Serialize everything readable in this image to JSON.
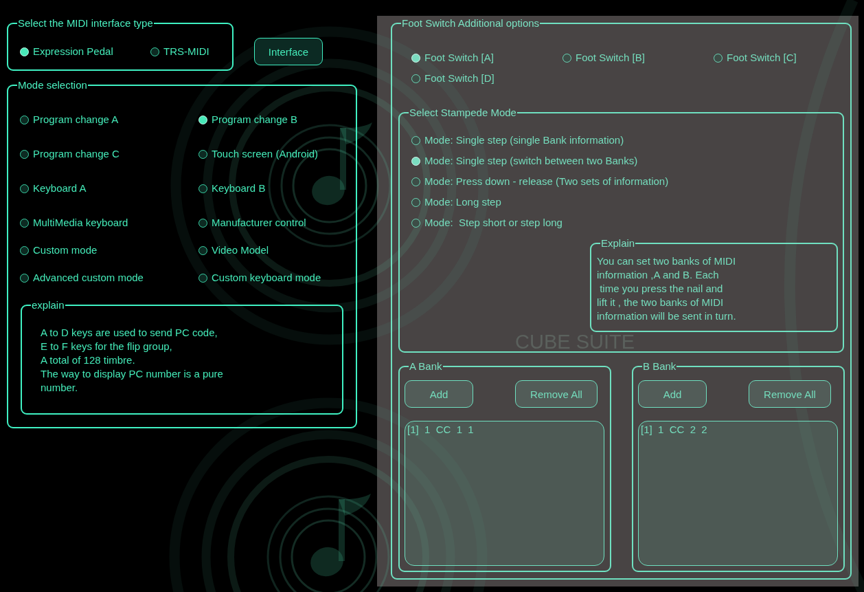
{
  "interface_type": {
    "title": "Select the MIDI interface type",
    "options": [
      {
        "label": "Expression Pedal",
        "selected": true
      },
      {
        "label": "TRS-MIDI",
        "selected": false
      }
    ]
  },
  "interface_button": {
    "label": "Interface"
  },
  "mode_selection": {
    "title": "Mode selection",
    "options": [
      {
        "label": "Program change A",
        "selected": false
      },
      {
        "label": "Program change B",
        "selected": true
      },
      {
        "label": "Program change C",
        "selected": false
      },
      {
        "label": "Touch screen (Android)",
        "selected": false
      },
      {
        "label": "Keyboard A",
        "selected": false
      },
      {
        "label": "Keyboard B",
        "selected": false
      },
      {
        "label": "MultiMedia keyboard",
        "selected": false
      },
      {
        "label": "Manufacturer control",
        "selected": false
      },
      {
        "label": "Custom mode",
        "selected": false
      },
      {
        "label": "Video Model",
        "selected": false
      },
      {
        "label": "Advanced custom mode",
        "selected": false
      },
      {
        "label": "Custom keyboard mode",
        "selected": false
      }
    ],
    "explain": {
      "title": "explain",
      "lines": [
        "A to D keys are used to send PC code,",
        "E to F keys for the flip group,",
        "A total of 128 timbre.",
        "The way to display PC number is a pure",
        "number."
      ]
    }
  },
  "foot_switch_options": {
    "title": "Foot Switch Additional options",
    "switches": [
      {
        "label": "Foot Switch [A]",
        "selected": true
      },
      {
        "label": "Foot Switch [B]",
        "selected": false
      },
      {
        "label": "Foot Switch [C]",
        "selected": false
      },
      {
        "label": "Foot Switch [D]",
        "selected": false
      }
    ],
    "stampede_mode": {
      "title": "Select Stampede Mode",
      "options": [
        {
          "label": "Mode: Single step (single Bank information)",
          "selected": false
        },
        {
          "label": "Mode: Single step (switch between two Banks)",
          "selected": true
        },
        {
          "label": "Mode: Press down - release (Two sets of information)",
          "selected": false
        },
        {
          "label": "Mode: Long step",
          "selected": false
        },
        {
          "label": "Mode:  Step short or step long",
          "selected": false
        }
      ],
      "explain": {
        "title": "Explain",
        "lines": [
          "You can set two banks of MIDI",
          "information ,A and B. Each",
          " time you press the nail and",
          "lift it , the two banks of MIDI",
          "information will be sent in turn."
        ]
      },
      "brand": "CUBE SUITE"
    },
    "banks": [
      {
        "title": "A Bank",
        "add_button": "Add",
        "remove_button": "Remove All",
        "entries": [
          "[1]  1  CC  1  1"
        ]
      },
      {
        "title": "B Bank",
        "add_button": "Add",
        "remove_button": "Remove All",
        "entries": [
          "[1]  1  CC  2  2"
        ]
      }
    ]
  }
}
